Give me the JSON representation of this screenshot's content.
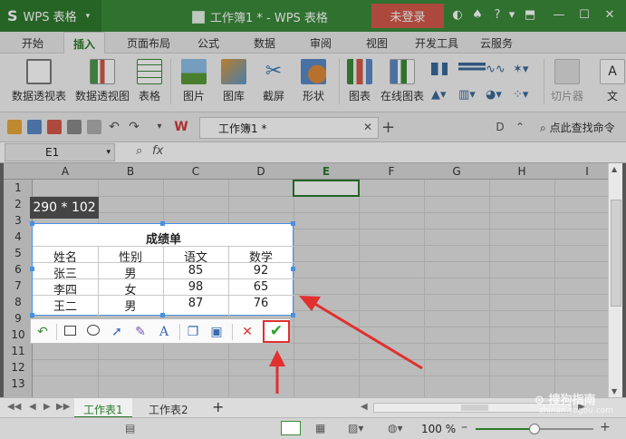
{
  "app": {
    "logo": "S",
    "name": "WPS 表格",
    "window_title": "工作簿1 * - WPS 表格",
    "login_label": "未登录",
    "accent_color": "#3b8a3b",
    "login_color": "#d25a4a"
  },
  "ribbon_tabs": [
    "开始",
    "插入",
    "页面布局",
    "公式",
    "数据",
    "审阅",
    "视图",
    "开发工具",
    "云服务"
  ],
  "active_tab": "插入",
  "ribbon_buttons": [
    "数据透视表",
    "数据透视图",
    "表格",
    "图片",
    "图库",
    "截屏",
    "形状",
    "图表",
    "在线图表",
    "切片器",
    "文"
  ],
  "doc_tab": "工作簿1 *",
  "find_command": "点此查找命令",
  "formula_bar": {
    "name_box": "E1",
    "fx": "fx"
  },
  "columns": [
    "A",
    "B",
    "C",
    "D",
    "E",
    "F",
    "G",
    "H",
    "I"
  ],
  "rows": [
    "1",
    "2",
    "3",
    "4",
    "5",
    "6",
    "7",
    "8",
    "9",
    "10",
    "11",
    "12",
    "13"
  ],
  "size_tooltip": "290 * 102",
  "capture": {
    "title": "成绩单",
    "headers": [
      "姓名",
      "性别",
      "语文",
      "数学"
    ],
    "rows": [
      [
        "张三",
        "男",
        "85",
        "92"
      ],
      [
        "李四",
        "女",
        "98",
        "65"
      ],
      [
        "王二",
        "男",
        "87",
        "76"
      ]
    ]
  },
  "capture_tools": [
    "undo-icon",
    "rectangle-icon",
    "ellipse-icon",
    "arrow-icon",
    "brush-icon",
    "text-icon",
    "copy-icon",
    "save-icon",
    "cancel-icon",
    "confirm-icon"
  ],
  "sheets": [
    "工作表1",
    "工作表2"
  ],
  "active_sheet": "工作表1",
  "zoom": {
    "label": "100 %",
    "fraction": 0.5
  },
  "watermark": {
    "text": "搜狗指南",
    "sub": "zhinan.sogou.com"
  },
  "annotation_color": "#e03030"
}
